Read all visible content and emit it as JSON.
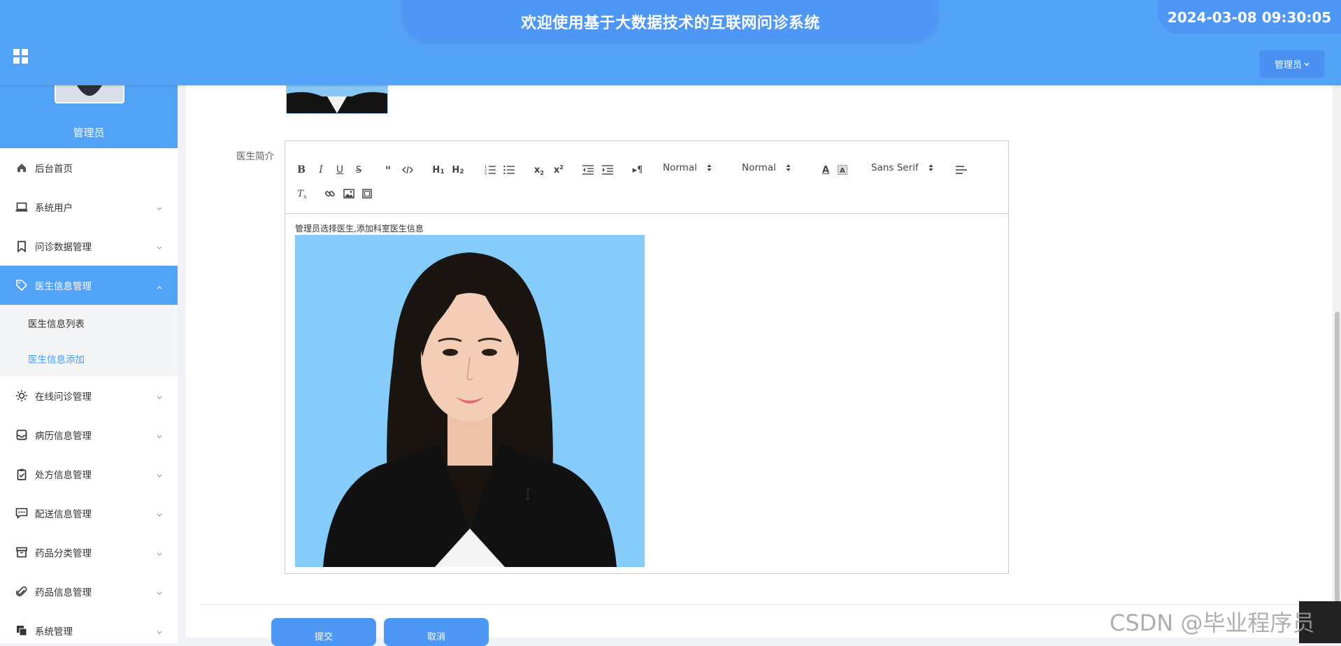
{
  "header": {
    "title": "欢迎使用基于大数据技术的互联网问诊系统",
    "datetime": "2024-03-08 09:30:05",
    "user_menu_label": "管理员",
    "menu_icon": "grid-icon",
    "accent_color": "#52a2f7"
  },
  "sidebar": {
    "role": "管理员",
    "items": [
      {
        "label": "后台首页",
        "icon": "home-icon"
      },
      {
        "label": "系统用户",
        "icon": "laptop-icon"
      },
      {
        "label": "问诊数据管理",
        "icon": "bookmark-icon"
      },
      {
        "label": "医生信息管理",
        "icon": "tag-icon",
        "active": true
      },
      {
        "label": "在线问诊管理",
        "icon": "sun-icon"
      },
      {
        "label": "病历信息管理",
        "icon": "inbox-icon"
      },
      {
        "label": "处方信息管理",
        "icon": "clipboard-check-icon"
      },
      {
        "label": "配送信息管理",
        "icon": "chat-icon"
      },
      {
        "label": "药品分类管理",
        "icon": "archive-icon"
      },
      {
        "label": "药品信息管理",
        "icon": "paperclip-icon"
      },
      {
        "label": "系统管理",
        "icon": "copy-icon"
      }
    ],
    "submenu": [
      {
        "label": "医生信息列表"
      },
      {
        "label": "医生信息添加",
        "current": true
      }
    ]
  },
  "form": {
    "intro_label": "医生简介",
    "editor": {
      "header_select": "Normal",
      "size_select": "Normal",
      "font_select": "Sans Serif",
      "content_text": "管理员选择医生,添加科室医生信息"
    },
    "submit_label": "提交",
    "cancel_label": "取消"
  },
  "watermark": "CSDN @毕业程序员"
}
